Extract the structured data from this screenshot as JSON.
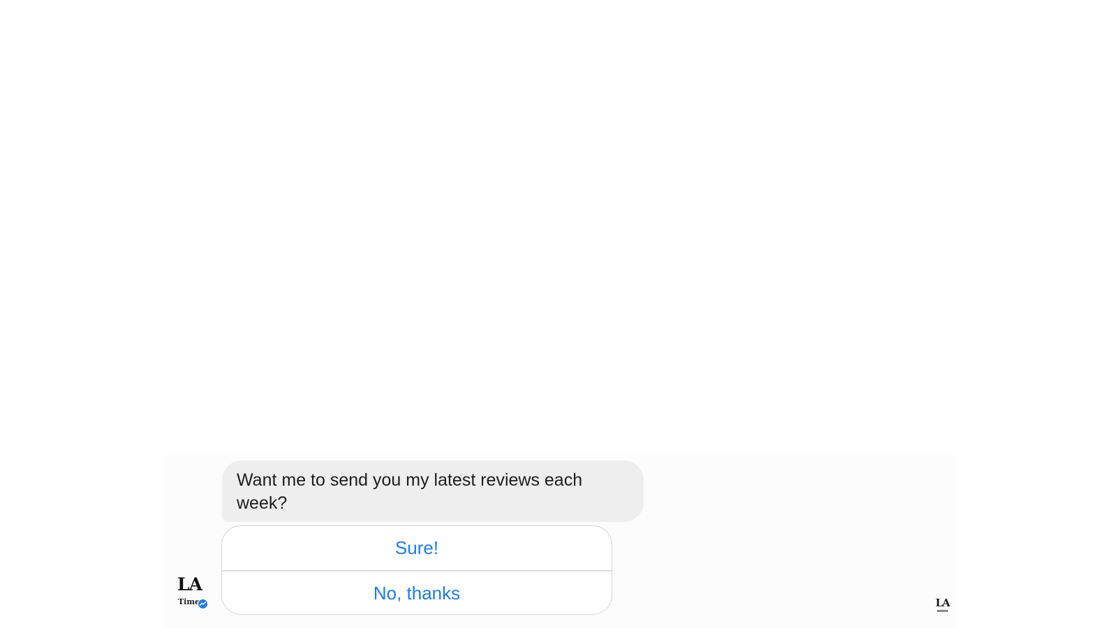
{
  "conversation": {
    "bot_message": "Want me to send you my latest reviews each week?",
    "quick_replies": [
      {
        "label": "Sure!"
      },
      {
        "label": "No, thanks"
      }
    ],
    "sender_avatar": {
      "monogram": "LA",
      "wordmark": "Times",
      "badge_icon": "messenger-badge-icon"
    },
    "read_receipt": {
      "monogram": "LA",
      "icon": "read-receipt-avatar-icon"
    }
  },
  "colors": {
    "bubble_background": "#eeeeee",
    "reply_text": "#1a7cf0",
    "badge": "#1a7cf0",
    "border": "#d6d6d6"
  }
}
